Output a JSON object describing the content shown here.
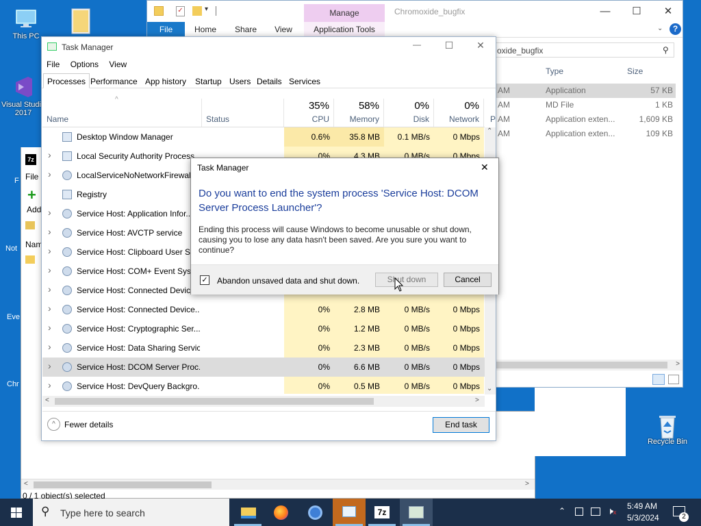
{
  "desktop": {
    "icons": [
      {
        "label": "This PC"
      },
      {
        "label": "Visual Studio 2017"
      },
      {
        "label": "Recycle Bin"
      }
    ],
    "partial_labels": [
      "F",
      "Not",
      "Eve",
      "Chr"
    ]
  },
  "explorer": {
    "tab_manage": "Manage",
    "title": "Chromoxide_bugfix",
    "tabs": [
      "File",
      "Home",
      "Share",
      "View",
      "Application Tools"
    ],
    "address": "oxide_bugfix",
    "columns": [
      "Type",
      "Size"
    ],
    "rows": [
      {
        "time": "AM",
        "type": "Application",
        "size": "57 KB"
      },
      {
        "time": "AM",
        "type": "MD File",
        "size": "1 KB"
      },
      {
        "time": "AM",
        "type": "Application exten...",
        "size": "1,609 KB"
      },
      {
        "time": "AM",
        "type": "Application exten...",
        "size": "109 KB"
      }
    ]
  },
  "explorer2": {
    "status": "0 / 1 object(s) selected",
    "file_label": "File",
    "add_label": "Add",
    "name_label": "Nam"
  },
  "taskmanager": {
    "title": "Task Manager",
    "menu": [
      "File",
      "Options",
      "View"
    ],
    "tabs": [
      "Processes",
      "Performance",
      "App history",
      "Startup",
      "Users",
      "Details",
      "Services"
    ],
    "columns": {
      "name": "Name",
      "status": "Status",
      "cpu_pct": "35%",
      "cpu": "CPU",
      "mem_pct": "58%",
      "mem": "Memory",
      "disk_pct": "0%",
      "disk": "Disk",
      "net_pct": "0%",
      "net": "Network",
      "power": "P"
    },
    "rows": [
      {
        "name": "Desktop Window Manager",
        "cpu": "0.6%",
        "mem": "35.8 MB",
        "disk": "0.1 MB/s",
        "net": "0 Mbps"
      },
      {
        "name": "Local Security Authority Process...",
        "cpu": "0%",
        "mem": "4.3 MB",
        "disk": "0 MB/s",
        "net": "0 Mbps"
      },
      {
        "name": "LocalServiceNoNetworkFirewall ...",
        "cpu": "",
        "mem": "",
        "disk": "",
        "net": ""
      },
      {
        "name": "Registry",
        "cpu": "",
        "mem": "",
        "disk": "",
        "net": ""
      },
      {
        "name": "Service Host: Application Infor...",
        "cpu": "",
        "mem": "",
        "disk": "",
        "net": ""
      },
      {
        "name": "Service Host: AVCTP service",
        "cpu": "",
        "mem": "",
        "disk": "",
        "net": ""
      },
      {
        "name": "Service Host: Clipboard User Ser...",
        "cpu": "",
        "mem": "",
        "disk": "",
        "net": ""
      },
      {
        "name": "Service Host: COM+ Event Syste...",
        "cpu": "",
        "mem": "",
        "disk": "",
        "net": ""
      },
      {
        "name": "Service Host: Connected Device...",
        "cpu": "",
        "mem": "",
        "disk": "",
        "net": ""
      },
      {
        "name": "Service Host: Connected Device...",
        "cpu": "0%",
        "mem": "2.8 MB",
        "disk": "0 MB/s",
        "net": "0 Mbps"
      },
      {
        "name": "Service Host: Cryptographic Ser...",
        "cpu": "0%",
        "mem": "1.2 MB",
        "disk": "0 MB/s",
        "net": "0 Mbps"
      },
      {
        "name": "Service Host: Data Sharing Service",
        "cpu": "0%",
        "mem": "2.3 MB",
        "disk": "0 MB/s",
        "net": "0 Mbps"
      },
      {
        "name": "Service Host: DCOM Server Proc...",
        "cpu": "0%",
        "mem": "6.6 MB",
        "disk": "0 MB/s",
        "net": "0 Mbps"
      },
      {
        "name": "Service Host: DevQuery Backgro...",
        "cpu": "0%",
        "mem": "0.5 MB",
        "disk": "0 MB/s",
        "net": "0 Mbps"
      }
    ],
    "fewer_details": "Fewer details",
    "end_task": "End task"
  },
  "dialog": {
    "title": "Task Manager",
    "heading": "Do you want to end the system process 'Service Host: DCOM Server Process Launcher'?",
    "body": "Ending this process will cause Windows to become unusable or shut down, causing you to lose any data hasn't been saved. Are you sure you want to continue?",
    "checkbox_label": "Abandon unsaved data and shut down.",
    "checkbox_checked": true,
    "shutdown_label": "Shut down",
    "cancel_label": "Cancel"
  },
  "taskbar": {
    "search_placeholder": "Type here to search",
    "time": "5:49 AM",
    "date": "5/3/2024",
    "notification_count": "2"
  }
}
